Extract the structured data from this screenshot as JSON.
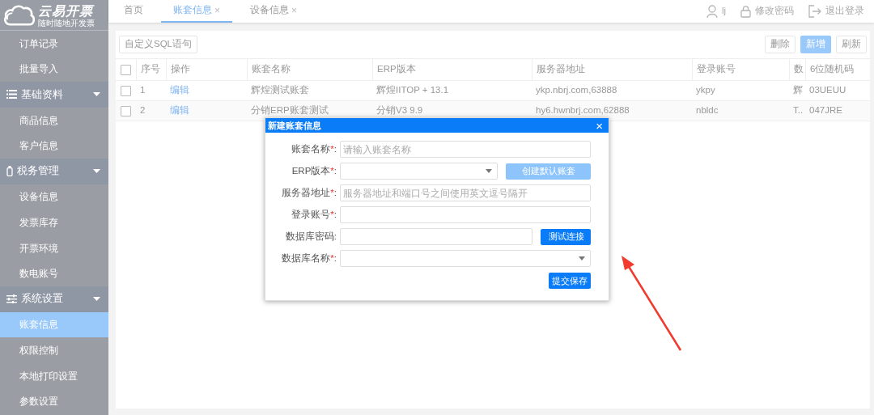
{
  "logo": {
    "title": "云易开票",
    "slogan": "随时随地开发票"
  },
  "sidebar": {
    "items": [
      {
        "kind": "item",
        "label": "订单记录",
        "selected": false
      },
      {
        "kind": "item",
        "label": "批量导入",
        "selected": false
      },
      {
        "kind": "group",
        "label": "基础资料",
        "expanded": true,
        "children": [
          {
            "label": "商品信息",
            "selected": false
          },
          {
            "label": "客户信息",
            "selected": false
          }
        ]
      },
      {
        "kind": "group",
        "label": "税务管理",
        "expanded": true,
        "children": [
          {
            "label": "设备信息",
            "selected": false
          },
          {
            "label": "发票库存",
            "selected": false
          },
          {
            "label": "开票环境",
            "selected": false
          },
          {
            "label": "数电账号",
            "selected": false
          }
        ]
      },
      {
        "kind": "group",
        "label": "系统设置",
        "expanded": true,
        "children": [
          {
            "label": "账套信息",
            "selected": true
          },
          {
            "label": "权限控制",
            "selected": false
          },
          {
            "label": "本地打印设置",
            "selected": false
          },
          {
            "label": "参数设置",
            "selected": false
          }
        ]
      }
    ]
  },
  "tabs": [
    {
      "label": "首页",
      "selected": false,
      "closable": false
    },
    {
      "label": "账套信息",
      "selected": true,
      "closable": true,
      "close": "×"
    },
    {
      "label": "设备信息",
      "selected": false,
      "closable": true,
      "close": "×"
    }
  ],
  "user_menu": [
    {
      "kind": "user",
      "label": "lj"
    },
    {
      "kind": "password",
      "label": "修改密码"
    },
    {
      "kind": "logout",
      "label": "退出登录"
    }
  ],
  "toolbar": {
    "left": [
      {
        "label": "自定义SQL语句"
      }
    ],
    "right": [
      {
        "label": "删除",
        "kind": "default"
      },
      {
        "label": "新增",
        "kind": "primary"
      },
      {
        "label": "刷新",
        "kind": "default"
      }
    ]
  },
  "table": {
    "header_checked": false,
    "columns": [
      "序号",
      "操作",
      "账套名称",
      "ERP版本",
      "服务器地址",
      "登录账号",
      "数",
      "6位随机码"
    ],
    "rows": [
      {
        "checked": false,
        "cells": [
          "1",
          "编辑",
          "辉煌测试账套",
          "辉煌IITOP +  13.1",
          "ykp.nbrj.com,63888",
          "ykpy",
          "辉",
          "03UEUU"
        ]
      },
      {
        "checked": false,
        "cells": [
          "2",
          "编辑",
          "分销ERP账套测试",
          "分销V3 9.9",
          "hy6.hwnbrj.com,62888",
          "nbldc",
          "T..",
          "047JRE"
        ]
      }
    ]
  },
  "dialog": {
    "title": "新建账套信息",
    "close": "×",
    "label_suffix": ":",
    "required_mark": "*",
    "fields": [
      {
        "kind": "text",
        "label": "账套名称",
        "required": true,
        "placeholder": "请输入账套名称"
      },
      {
        "kind": "select",
        "label": "ERP版本",
        "required": true,
        "button": {
          "label": "创建默认账套",
          "disabled": true
        }
      },
      {
        "kind": "text",
        "label": "服务器地址",
        "required": true,
        "placeholder": "服务器地址和端口号之间使用英文逗号隔开"
      },
      {
        "kind": "text",
        "label": "登录账号",
        "required": true
      },
      {
        "kind": "text",
        "label": "数据库密码",
        "required": false,
        "button": {
          "label": "测试连接",
          "disabled": false
        }
      },
      {
        "kind": "select",
        "label": "数据库名称",
        "required": true
      }
    ],
    "submit": "提交保存"
  }
}
